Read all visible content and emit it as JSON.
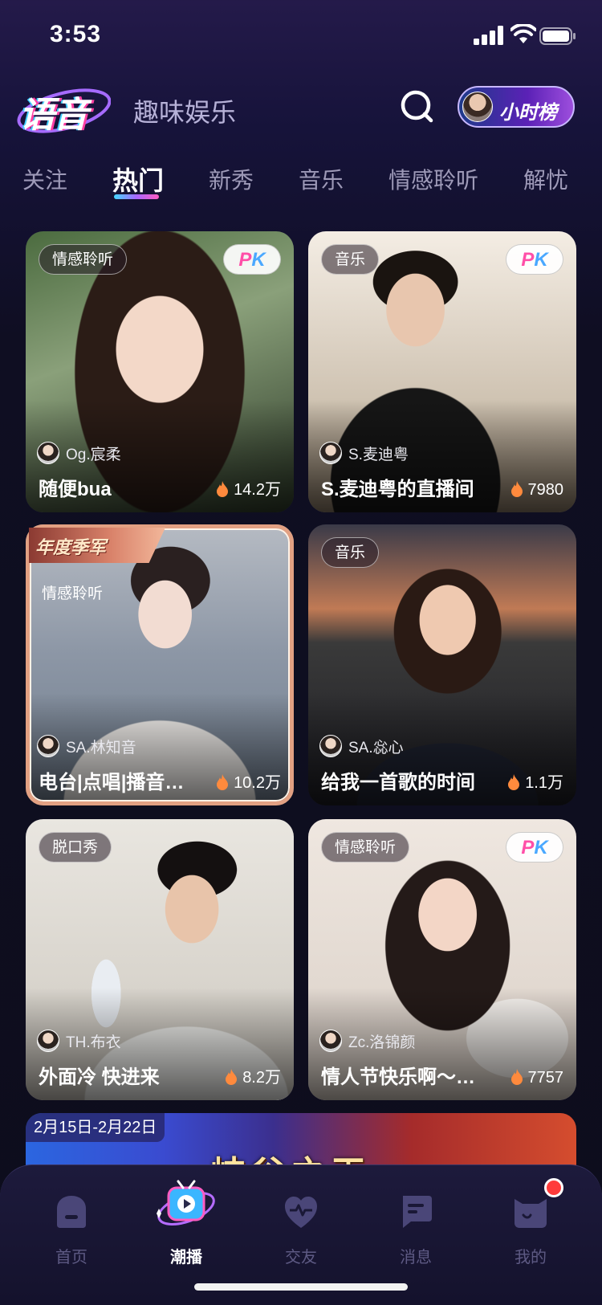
{
  "status_bar": {
    "time": "3:53"
  },
  "header": {
    "logo": "语音",
    "subtitle": "趣味娱乐",
    "rank_button": "小时榜"
  },
  "tabs": [
    "关注",
    "热门",
    "新秀",
    "音乐",
    "情感聆听",
    "解忧"
  ],
  "active_tab": "热门",
  "cards": [
    {
      "category": "情感聆听",
      "pk": "PK",
      "host": "Og.宸柔",
      "title": "随便bua",
      "heat": "14.2万"
    },
    {
      "category": "音乐",
      "pk": "PK",
      "host": "S.麦迪粤",
      "title": "S.麦迪粤的直播间",
      "heat": "7980"
    },
    {
      "category": "情感聆听",
      "award": "年度季军",
      "host": "SA.林知音",
      "title": "电台|点唱|播音…",
      "heat": "10.2万"
    },
    {
      "category": "音乐",
      "host": "SA.惢心",
      "title": "给我一首歌的时间",
      "heat": "1.1万"
    },
    {
      "category": "脱口秀",
      "host": "TH.布衣",
      "title": "外面冷 快进来",
      "heat": "8.2万"
    },
    {
      "category": "情感聆听",
      "pk": "PK",
      "host": "Zc.洛锦颜",
      "title": "情人节快乐啊～…",
      "heat": "7757"
    }
  ],
  "banner": {
    "date": "2月15日-2月22日",
    "title": "峡谷之王"
  },
  "tabbar": [
    {
      "label": "首页",
      "icon": "home-icon"
    },
    {
      "label": "潮播",
      "icon": "tv-play-icon"
    },
    {
      "label": "交友",
      "icon": "heart-icon"
    },
    {
      "label": "消息",
      "icon": "message-icon"
    },
    {
      "label": "我的",
      "icon": "profile-cat-icon"
    }
  ],
  "active_tabbar": "潮播",
  "colors": {
    "accent_pink": "#ff4fa8",
    "accent_blue": "#4aa8ff",
    "background": "#0f0e22"
  }
}
